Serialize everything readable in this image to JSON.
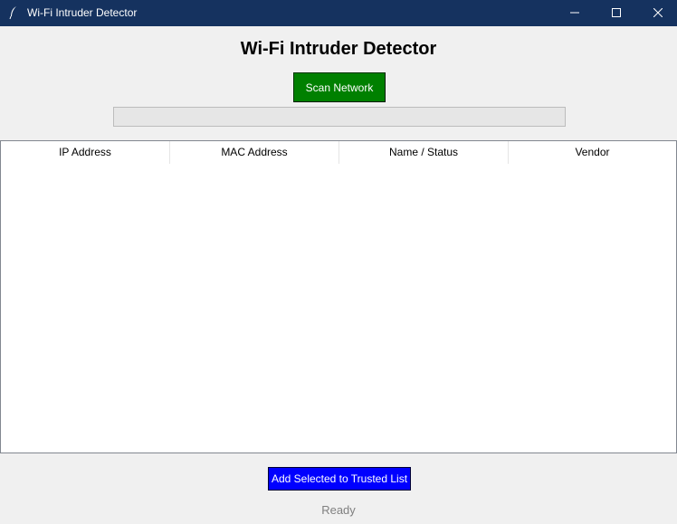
{
  "window": {
    "title": "Wi-Fi Intruder Detector",
    "icon": "feather-icon",
    "controls": [
      "minimize-icon",
      "maximize-icon",
      "close-icon"
    ]
  },
  "header": {
    "title": "Wi-Fi Intruder Detector"
  },
  "toolbar": {
    "scan_label": "Scan Network"
  },
  "progress": {
    "value": 0
  },
  "table": {
    "columns": [
      "IP Address",
      "MAC Address",
      "Name / Status",
      "Vendor"
    ],
    "rows": []
  },
  "actions": {
    "trust_label": "Add Selected to Trusted List"
  },
  "status": {
    "text": "Ready"
  },
  "colors": {
    "titlebar": "#15325f",
    "scan_button": "#008000",
    "trust_button": "#0000ff",
    "status_text": "#808080"
  }
}
